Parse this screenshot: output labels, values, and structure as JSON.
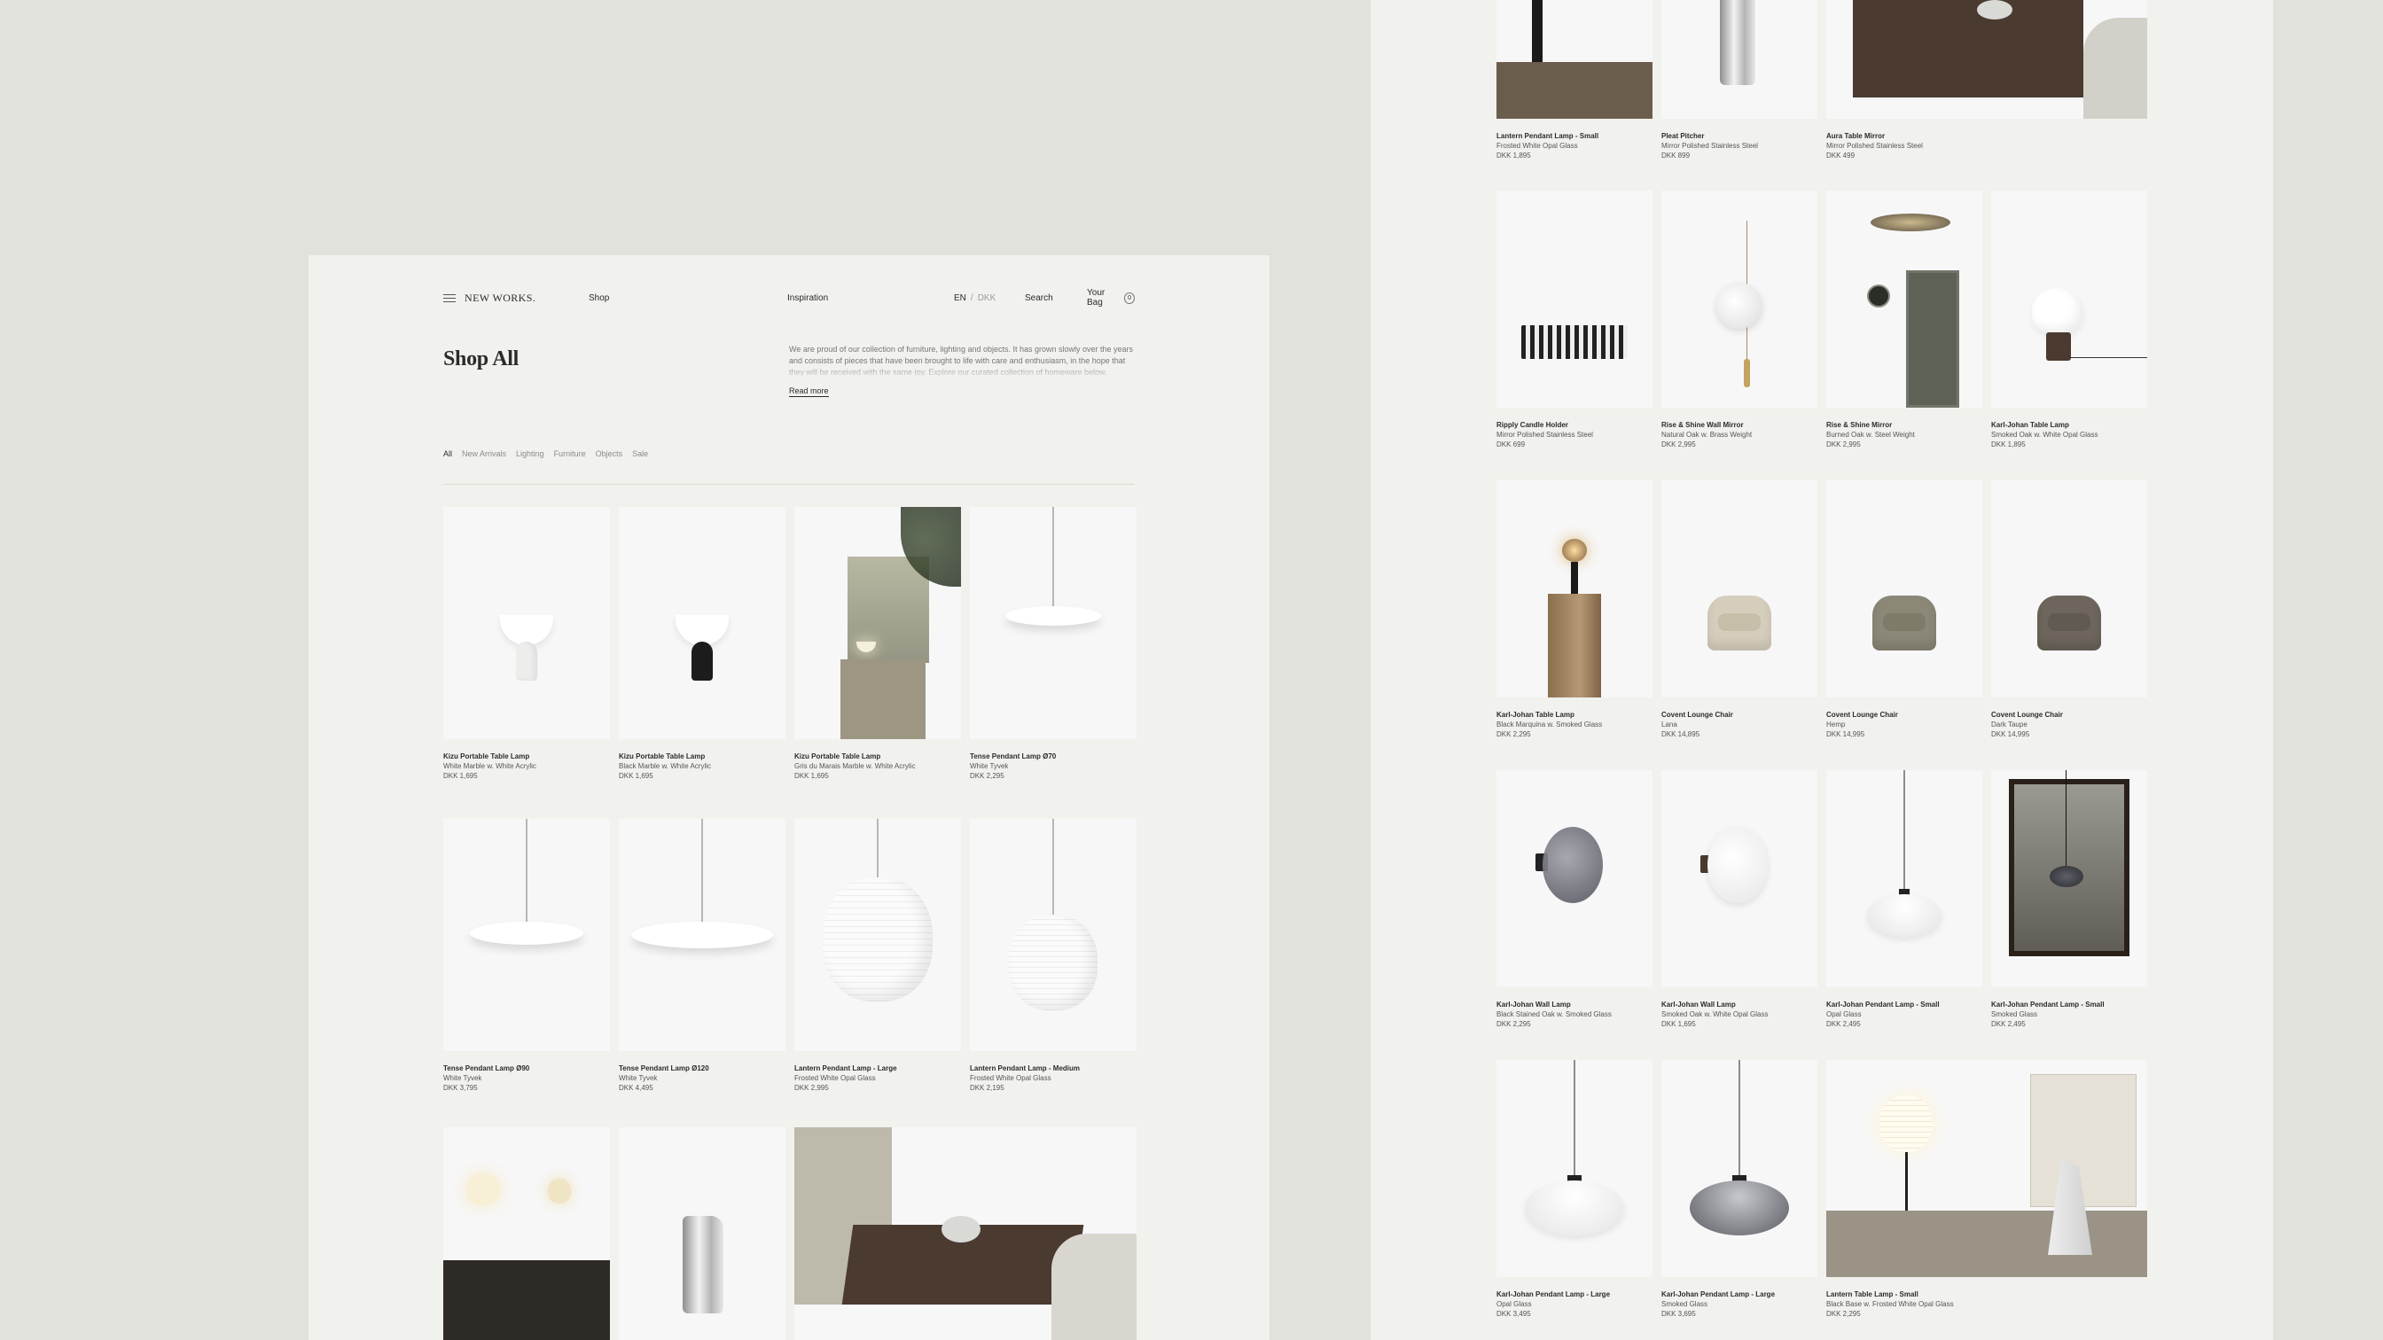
{
  "nav": {
    "logo": "NEW WORKS.",
    "shop": "Shop",
    "inspiration": "Inspiration",
    "lang_en": "EN",
    "lang_sep": "/",
    "lang_dkk": "DKK",
    "search": "Search",
    "bag": "Your Bag",
    "bag_count": "0"
  },
  "page": {
    "title": "Shop All",
    "intro": "We are proud of our collection of furniture, lighting and objects. It has grown slowly over the years and consists of pieces that have been brought to life with care and enthusiasm, in the hope that they will be received with the same joy. Explore our curated collection of homeware below.",
    "read_more": "Read more"
  },
  "filters": [
    "All",
    "New Arrivals",
    "Lighting",
    "Furniture",
    "Objects",
    "Sale"
  ],
  "left_products": [
    {
      "name": "Kizu Portable Table Lamp",
      "material": "White Marble w. White Acrylic",
      "price": "DKK 1,695"
    },
    {
      "name": "Kizu Portable Table Lamp",
      "material": "Black Marble w. White Acrylic",
      "price": "DKK 1,695"
    },
    {
      "name": "Kizu Portable Table Lamp",
      "material": "Gris du Marais Marble w. White Acrylic",
      "price": "DKK 1,695"
    },
    {
      "name": "Tense Pendant Lamp Ø70",
      "material": "White Tyvek",
      "price": "DKK 2,295"
    },
    {
      "name": "Tense Pendant Lamp Ø90",
      "material": "White Tyvek",
      "price": "DKK 3,795"
    },
    {
      "name": "Tense Pendant Lamp Ø120",
      "material": "White Tyvek",
      "price": "DKK 4,495"
    },
    {
      "name": "Lantern Pendant Lamp - Large",
      "material": "Frosted White Opal Glass",
      "price": "DKK 2,995"
    },
    {
      "name": "Lantern Pendant Lamp - Medium",
      "material": "Frosted White Opal Glass",
      "price": "DKK 2,195"
    }
  ],
  "right_products": [
    {
      "name": "Lantern Pendant Lamp - Small",
      "material": "Frosted White Opal Glass",
      "price": "DKK 1,895"
    },
    {
      "name": "Pleat Pitcher",
      "material": "Mirror Polished Stainless Steel",
      "price": "DKK 899"
    },
    {
      "name": "Aura Table Mirror",
      "material": "Mirror Polished Stainless Steel",
      "price": "DKK 499"
    },
    {
      "name": "Ripply Candle Holder",
      "material": "Mirror Polished Stainless Steel",
      "price": "DKK 699"
    },
    {
      "name": "Rise & Shine Wall Mirror",
      "material": "Natural Oak w. Brass Weight",
      "price": "DKK 2,995"
    },
    {
      "name": "Rise & Shine Mirror",
      "material": "Burned Oak w. Steel Weight",
      "price": "DKK 2,995"
    },
    {
      "name": "Karl-Johan Table Lamp",
      "material": "Smoked Oak w. White Opal Glass",
      "price": "DKK 1,895"
    },
    {
      "name": "Karl-Johan Table Lamp",
      "material": "Black Marquina w. Smoked Glass",
      "price": "DKK 2,295"
    },
    {
      "name": "Covent Lounge Chair",
      "material": "Lana",
      "price": "DKK 14,895"
    },
    {
      "name": "Covent Lounge Chair",
      "material": "Hemp",
      "price": "DKK 14,995"
    },
    {
      "name": "Covent Lounge Chair",
      "material": "Dark Taupe",
      "price": "DKK 14,995"
    },
    {
      "name": "Karl-Johan Wall Lamp",
      "material": "Black Stained Oak w. Smoked Glass",
      "price": "DKK 2,295"
    },
    {
      "name": "Karl-Johan Wall Lamp",
      "material": "Smoked Oak w. White Opal Glass",
      "price": "DKK 1,695"
    },
    {
      "name": "Karl-Johan Pendant Lamp - Small",
      "material": "Opal Glass",
      "price": "DKK 2,495"
    },
    {
      "name": "Karl-Johan Pendant Lamp - Small",
      "material": "Smoked Glass",
      "price": "DKK 2,495"
    },
    {
      "name": "Karl-Johan Pendant Lamp - Large",
      "material": "Opal Glass",
      "price": "DKK 3,495"
    },
    {
      "name": "Karl-Johan Pendant Lamp - Large",
      "material": "Smoked Glass",
      "price": "DKK 3,695"
    },
    {
      "name": "Lantern Table Lamp - Small",
      "material": "Black Base w. Frosted White Opal Glass",
      "price": "DKK 2,295"
    }
  ]
}
